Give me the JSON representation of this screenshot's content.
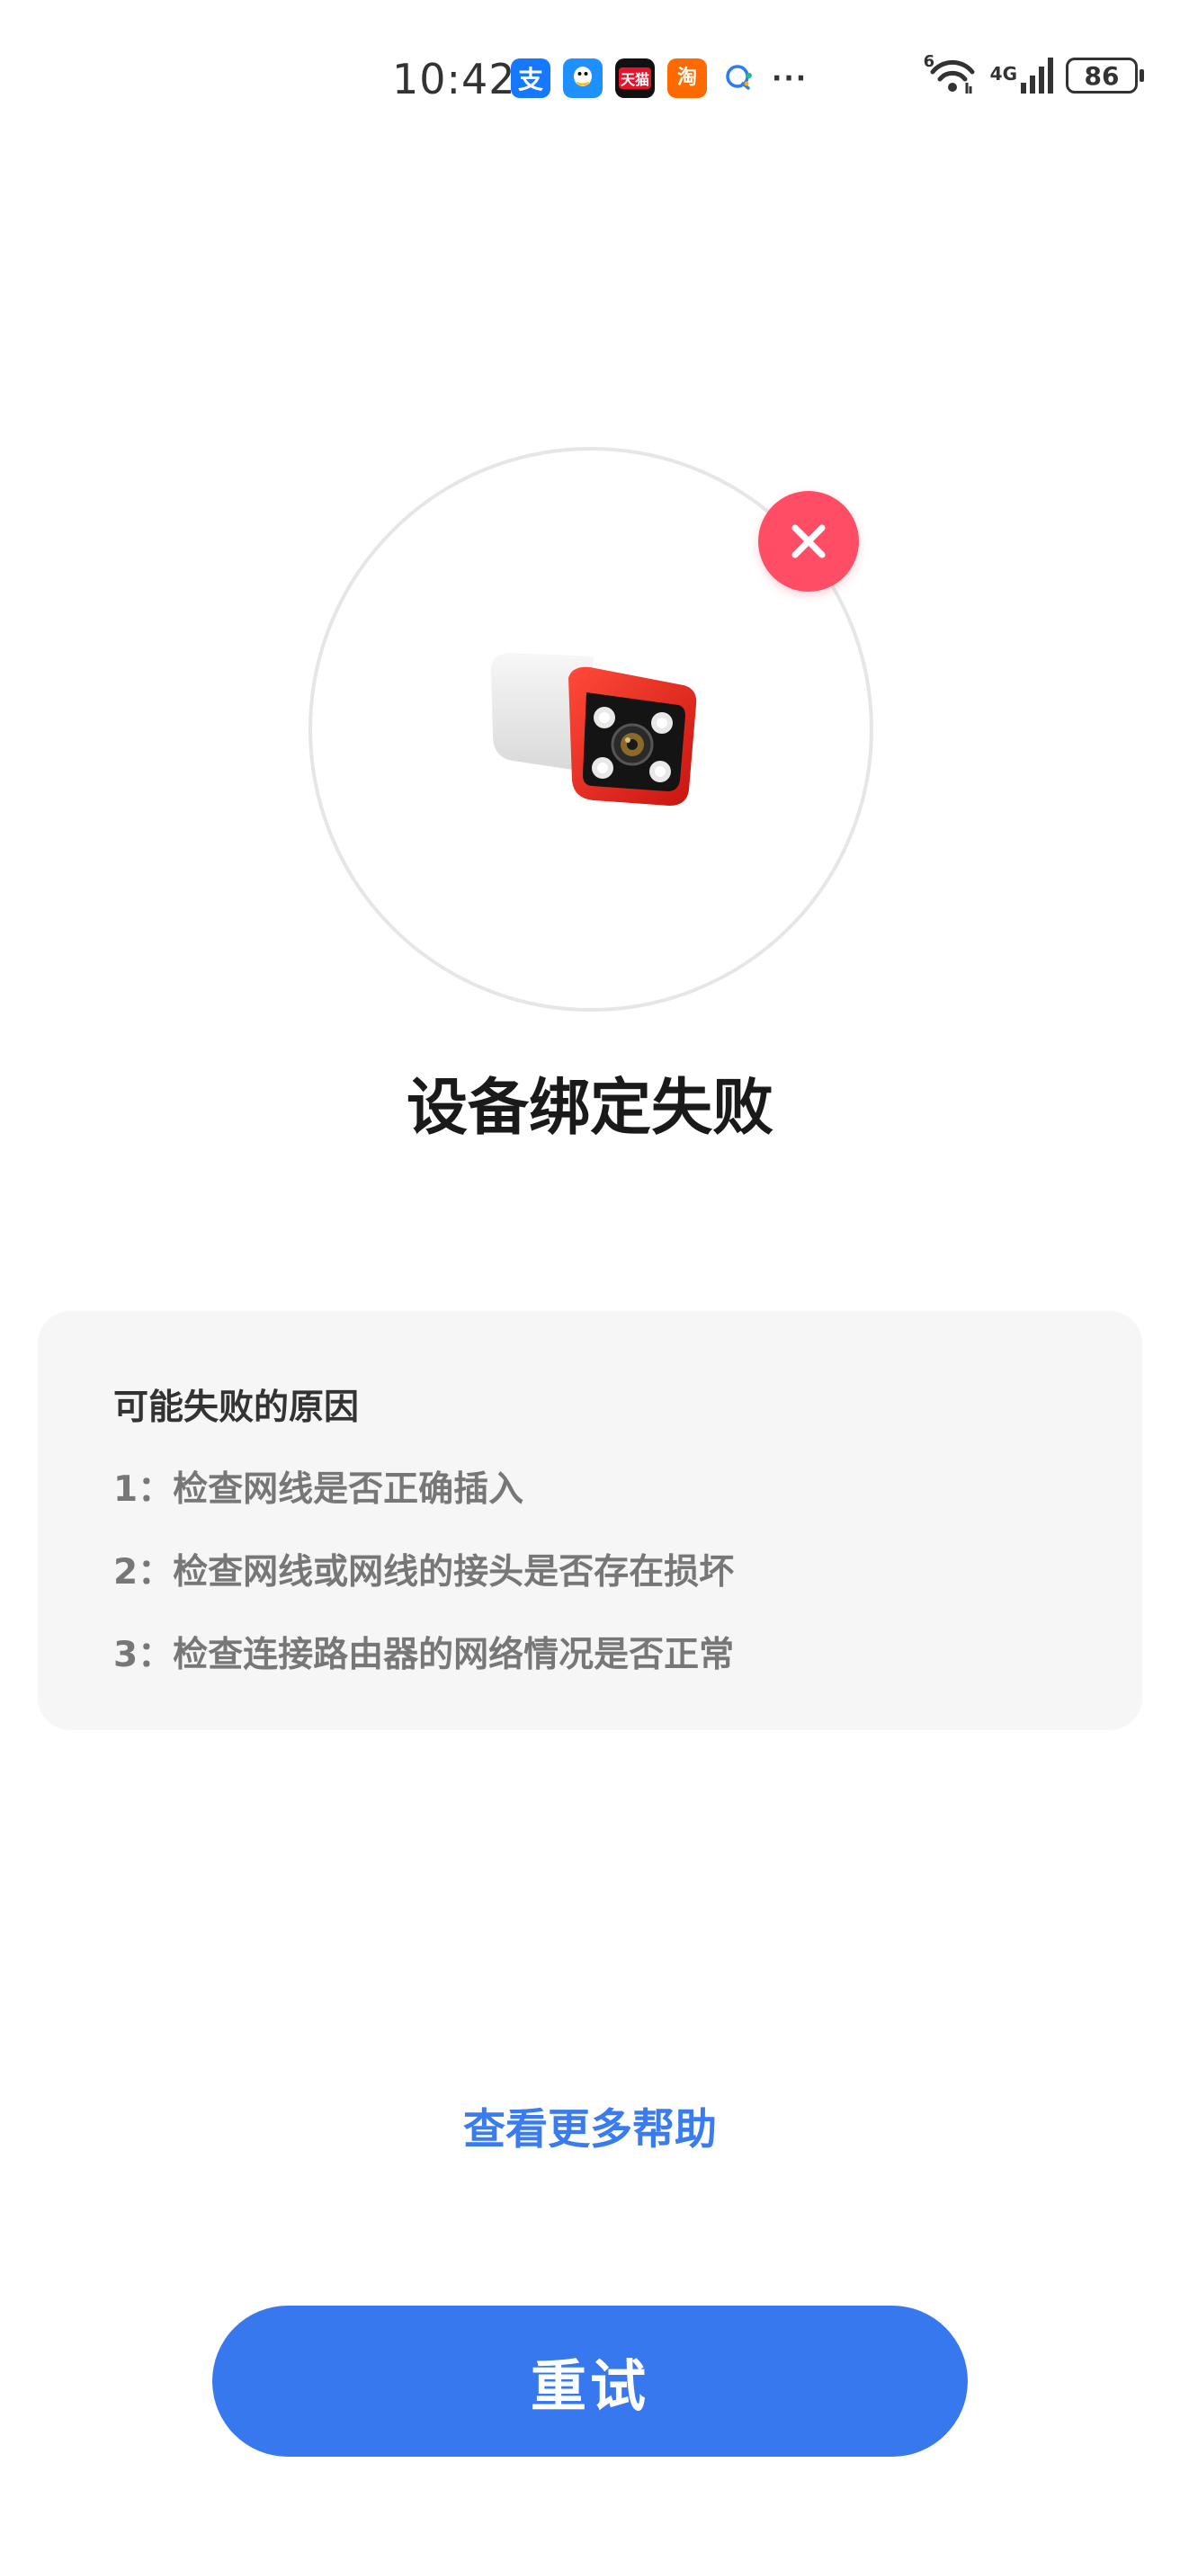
{
  "status_bar": {
    "time": "10:42",
    "apps": [
      {
        "icon": "alipay-icon",
        "label": "支"
      },
      {
        "icon": "qq-icon",
        "label": ""
      },
      {
        "icon": "tmall-icon",
        "label": "天猫"
      },
      {
        "icon": "taobao-icon",
        "label": "淘"
      },
      {
        "icon": "chat-bubble-icon",
        "label": ""
      }
    ],
    "more": "···",
    "network_type": "4G",
    "wifi_label": "6",
    "battery": "86"
  },
  "illustration": {
    "device": "camera-icon",
    "badge": "error-x-icon",
    "badge_color": "#ff4d66"
  },
  "title": "设备绑定失败",
  "reasons": {
    "heading": "可能失败的原因",
    "items": [
      "1：检查网线是否正确插入",
      "2：检查网线或网线的接头是否存在损坏",
      "3：检查连接路由器的网络情况是否正常"
    ]
  },
  "help_link": "查看更多帮助",
  "retry_button": "重试",
  "colors": {
    "accent": "#3878ee",
    "link": "#3a7bef",
    "error": "#ff4d66",
    "card_bg": "#f6f6f6"
  }
}
